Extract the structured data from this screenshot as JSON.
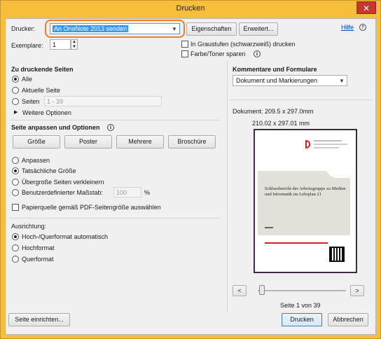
{
  "window": {
    "title": "Drucken",
    "close_glyph": "✕"
  },
  "printer": {
    "label": "Drucker:",
    "selected": "An OneNote 2013 senden",
    "highlight_color": "#f07d1e"
  },
  "buttons": {
    "properties": "Eigenschaften",
    "advanced": "Erweitert...",
    "help": "Hilfe",
    "page_setup": "Seite einrichten...",
    "print": "Drucken",
    "cancel": "Abbrechen"
  },
  "copies": {
    "label": "Exemplare:",
    "value": "1"
  },
  "options": {
    "grayscale": "In Graustufen (schwarzweiß) drucken",
    "save_toner": "Farbe/Toner sparen"
  },
  "pages": {
    "heading": "Zu druckende Seiten",
    "all": "Alle",
    "current": "Aktuelle Seite",
    "pages": "Seiten",
    "range_placeholder": "1 - 39",
    "more": "Weitere Optionen"
  },
  "sizing": {
    "heading": "Seite anpassen und Optionen",
    "tabs": [
      "Größe",
      "Poster",
      "Mehrere",
      "Broschüre"
    ],
    "fit": "Anpassen",
    "actual": "Tatsächliche Größe",
    "shrink": "Übergroße Seiten verkleinern",
    "custom": "Benutzerdefinierter Maßstab:",
    "custom_value": "100",
    "percent": "%",
    "paper_source": "Papierquelle gemäß PDF-Seitengröße auswählen"
  },
  "orientation": {
    "heading": "Ausrichtung:",
    "auto": "Hoch-/Querformat automatisch",
    "portrait": "Hochformat",
    "landscape": "Querformat"
  },
  "comments": {
    "heading": "Kommentare und Formulare",
    "selected": "Dokument und Markierungen"
  },
  "preview": {
    "doc_size": "Dokument: 209.5 x 297.0mm",
    "paper_size": "210.02 x 297.01 mm",
    "page_title": "Schlussbericht der Arbeitsgruppe zu Medien und Informatik im Lehrplan 21",
    "page_counter": "Seite 1 von 39",
    "prev": "<",
    "next": ">"
  }
}
